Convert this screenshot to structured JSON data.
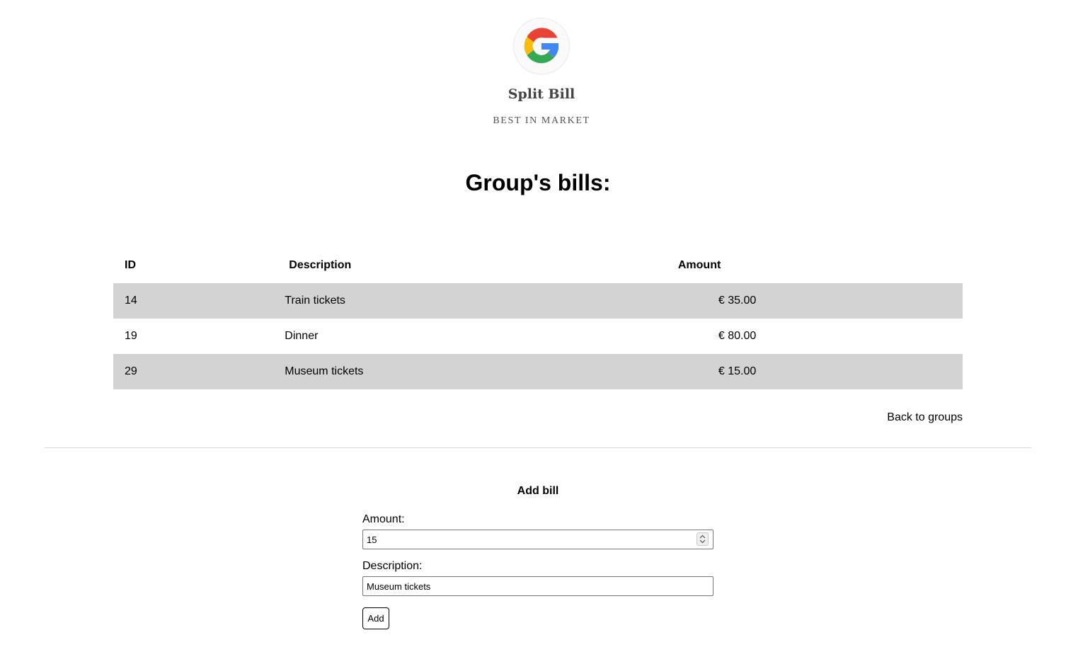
{
  "brand": {
    "logo_icon": "google-g-icon",
    "name": "Split Bill",
    "tagline": "BEST IN MARKET"
  },
  "page_title": "Group's bills:",
  "bills_table": {
    "headers": [
      "ID",
      "Description",
      "Amount"
    ],
    "rows": [
      {
        "id": "14",
        "description": "Train tickets",
        "amount": "€ 35.00"
      },
      {
        "id": "19",
        "description": "Dinner",
        "amount": "€ 80.00"
      },
      {
        "id": "29",
        "description": "Museum tickets",
        "amount": "€ 15.00"
      }
    ],
    "shaded_row_color": "#d3d3d3"
  },
  "back_link": "Back to groups",
  "add_form": {
    "title": "Add bill",
    "amount_label": "Amount:",
    "amount_value": "15",
    "description_label": "Description:",
    "description_value": "Museum tickets",
    "submit_label": "Add"
  }
}
